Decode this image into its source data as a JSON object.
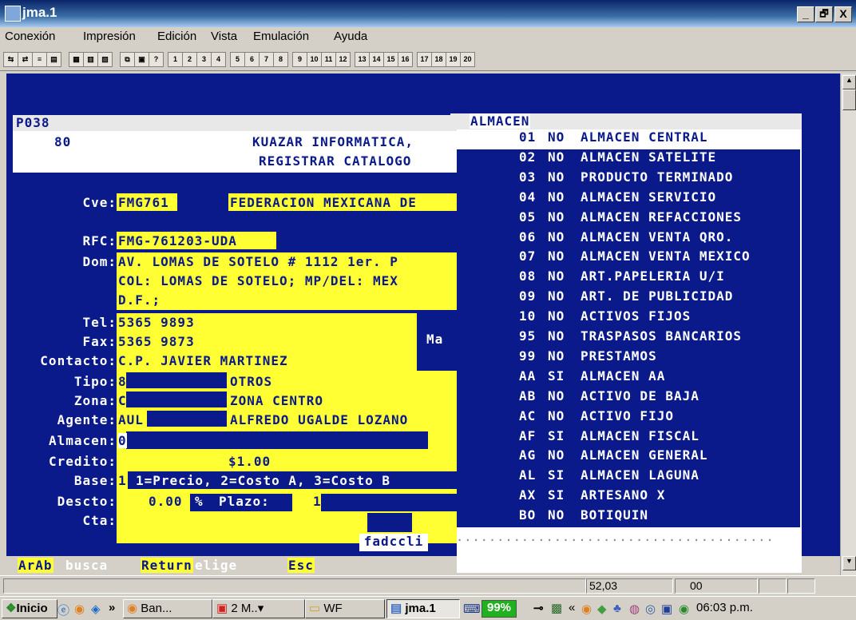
{
  "window": {
    "title": "jma.1",
    "min": "_",
    "max": "🗗",
    "close": "X"
  },
  "menu": [
    "Conexión",
    "Impresión",
    "Edición",
    "Vista",
    "Emulación",
    "Ayuda"
  ],
  "toolbar": {
    "fkeys": [
      "1",
      "2",
      "3",
      "4",
      "5",
      "6",
      "7",
      "8",
      "9",
      "10",
      "11",
      "12",
      "13",
      "14",
      "15",
      "16",
      "17",
      "18",
      "19",
      "20"
    ]
  },
  "form": {
    "program_id": "P038",
    "company_num": "80",
    "company_name": "KUAZAR INFORMATICA,",
    "screen_title": "REGISTRAR CATALOGO",
    "cve_label": "Cve:",
    "cve_value": "FMG761",
    "cve_name": "FEDERACION MEXICANA DE",
    "rfc_label": "RFC:",
    "rfc_value": "FMG-761203-UDA",
    "dom_label": "Dom:",
    "dom_line1": "AV. LOMAS DE SOTELO # 1112 1er. P",
    "dom_line2": "COL: LOMAS DE SOTELO; MP/DEL: MEX",
    "dom_line3": "D.F.;",
    "tel_label": "Tel:",
    "tel_value": "5365 9893",
    "fax_label": "Fax:",
    "fax_value": "5365 9873",
    "ma_text": "Ma",
    "contacto_label": "Contacto:",
    "contacto_value": "C.P. JAVIER MARTINEZ",
    "tipo_label": "Tipo:",
    "tipo_code": "8",
    "tipo_desc": "OTROS",
    "zona_label": "Zona:",
    "zona_code": "CE",
    "zona_desc": "ZONA CENTRO",
    "agente_label": "Agente:",
    "agente_code": "AUL",
    "agente_desc": "ALFREDO UGALDE LOZANO",
    "almacen_label": "Almacen:",
    "almacen_value": "0",
    "credito_label": "Credito:",
    "credito_value": "$1.00",
    "base_label": "Base:",
    "base_value": "1",
    "base_hint": "1=Precio, 2=Costo A, 3=Costo B",
    "descto_label": "Descto:",
    "descto_value": "0.00",
    "percent": "%",
    "plazo_label": "Plazo:",
    "plazo_value": "1",
    "cta_label": "Cta:",
    "footer_prog": "fadccli"
  },
  "almacen_popup": {
    "title": "ALMACEN",
    "items": [
      {
        "code": "01",
        "flag": "NO",
        "desc": "ALMACEN CENTRAL"
      },
      {
        "code": "02",
        "flag": "NO",
        "desc": "ALMACEN SATELITE"
      },
      {
        "code": "03",
        "flag": "NO",
        "desc": "PRODUCTO TERMINADO"
      },
      {
        "code": "04",
        "flag": "NO",
        "desc": "ALMACEN SERVICIO"
      },
      {
        "code": "05",
        "flag": "NO",
        "desc": "ALMACEN REFACCIONES"
      },
      {
        "code": "06",
        "flag": "NO",
        "desc": "ALMACEN VENTA QRO."
      },
      {
        "code": "07",
        "flag": "NO",
        "desc": "ALMACEN VENTA MEXICO"
      },
      {
        "code": "08",
        "flag": "NO",
        "desc": "ART.PAPELERIA U/I"
      },
      {
        "code": "09",
        "flag": "NO",
        "desc": "ART. DE PUBLICIDAD"
      },
      {
        "code": "10",
        "flag": "NO",
        "desc": "ACTIVOS FIJOS"
      },
      {
        "code": "95",
        "flag": "NO",
        "desc": "TRASPASOS BANCARIOS"
      },
      {
        "code": "99",
        "flag": "NO",
        "desc": "PRESTAMOS"
      },
      {
        "code": "AA",
        "flag": "SI",
        "desc": "ALMACEN AA"
      },
      {
        "code": "AB",
        "flag": "NO",
        "desc": "ACTIVO DE BAJA"
      },
      {
        "code": "AC",
        "flag": "NO",
        "desc": "ACTIVO FIJO"
      },
      {
        "code": "AF",
        "flag": "SI",
        "desc": "ALMACEN FISCAL"
      },
      {
        "code": "AG",
        "flag": "NO",
        "desc": "ALMACEN GENERAL"
      },
      {
        "code": "AL",
        "flag": "SI",
        "desc": "ALMACEN LAGUNA"
      },
      {
        "code": "AX",
        "flag": "SI",
        "desc": "ARTESANO X"
      },
      {
        "code": "BO",
        "flag": "NO",
        "desc": "BOTIQUIN"
      }
    ],
    "dots": "......................................."
  },
  "keys": {
    "k1": "ArAb",
    "k1_desc": "busca",
    "k2": "Return",
    "k2_desc": "elige",
    "k3": "Esc"
  },
  "status": {
    "cursor_pos": "52,03",
    "code": "00"
  },
  "taskbar": {
    "start": "Inicio",
    "chev": "»",
    "items": [
      "Ban...",
      "2 M..▾",
      "WF",
      "jma.1"
    ],
    "battery": "99%",
    "clock": "06:03 p.m."
  }
}
